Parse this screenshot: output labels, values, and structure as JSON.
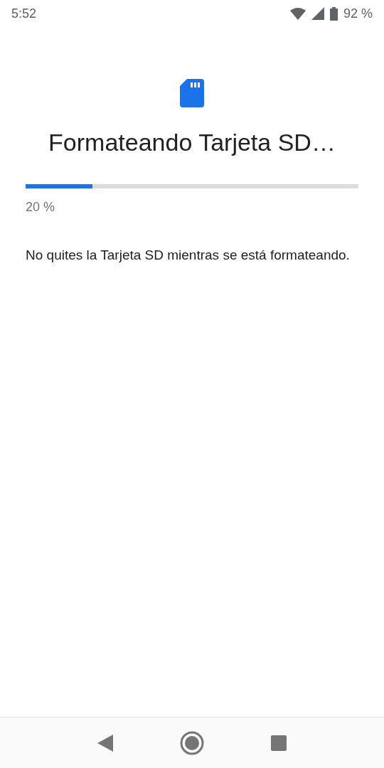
{
  "status_bar": {
    "time": "5:52",
    "battery": "92 %"
  },
  "title": "Formateando Tarjeta SD…",
  "progress": {
    "level": 0.2,
    "reading": "20 %"
  },
  "message": "No quites la Tarjeta SD mientras se está formateando."
}
